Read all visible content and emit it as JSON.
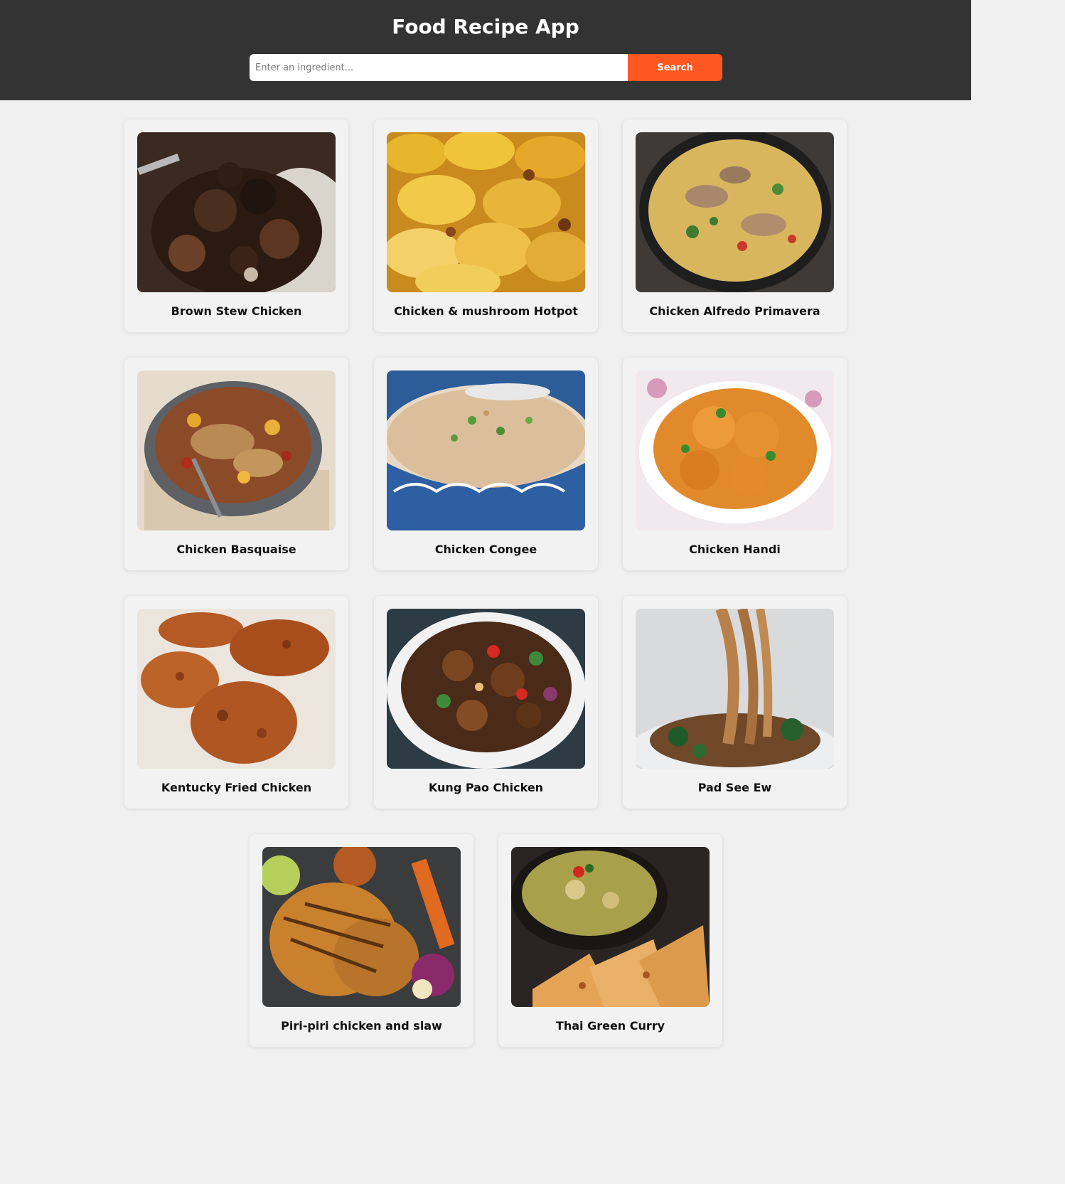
{
  "header": {
    "title": "Food Recipe App",
    "search_placeholder": "Enter an ingredient...",
    "search_value": "",
    "search_button_label": "Search"
  },
  "colors": {
    "header_bg": "#333333",
    "accent": "#ff5722",
    "page_bg": "#f0f0f0"
  },
  "recipes": [
    {
      "name": "Brown Stew Chicken",
      "photo": "stew-dark"
    },
    {
      "name": "Chicken & mushroom Hotpot",
      "photo": "potato-bake"
    },
    {
      "name": "Chicken Alfredo Primavera",
      "photo": "pasta-pan"
    },
    {
      "name": "Chicken Basquaise",
      "photo": "casserole"
    },
    {
      "name": "Chicken Congee",
      "photo": "congee-bowl"
    },
    {
      "name": "Chicken Handi",
      "photo": "curry-bowl"
    },
    {
      "name": "Kentucky Fried Chicken",
      "photo": "fried-chicken"
    },
    {
      "name": "Kung Pao Chicken",
      "photo": "stir-fry"
    },
    {
      "name": "Pad See Ew",
      "photo": "noodles"
    },
    {
      "name": "Piri-piri chicken and slaw",
      "photo": "grilled-chicken"
    },
    {
      "name": "Thai Green Curry",
      "photo": "green-curry"
    }
  ]
}
